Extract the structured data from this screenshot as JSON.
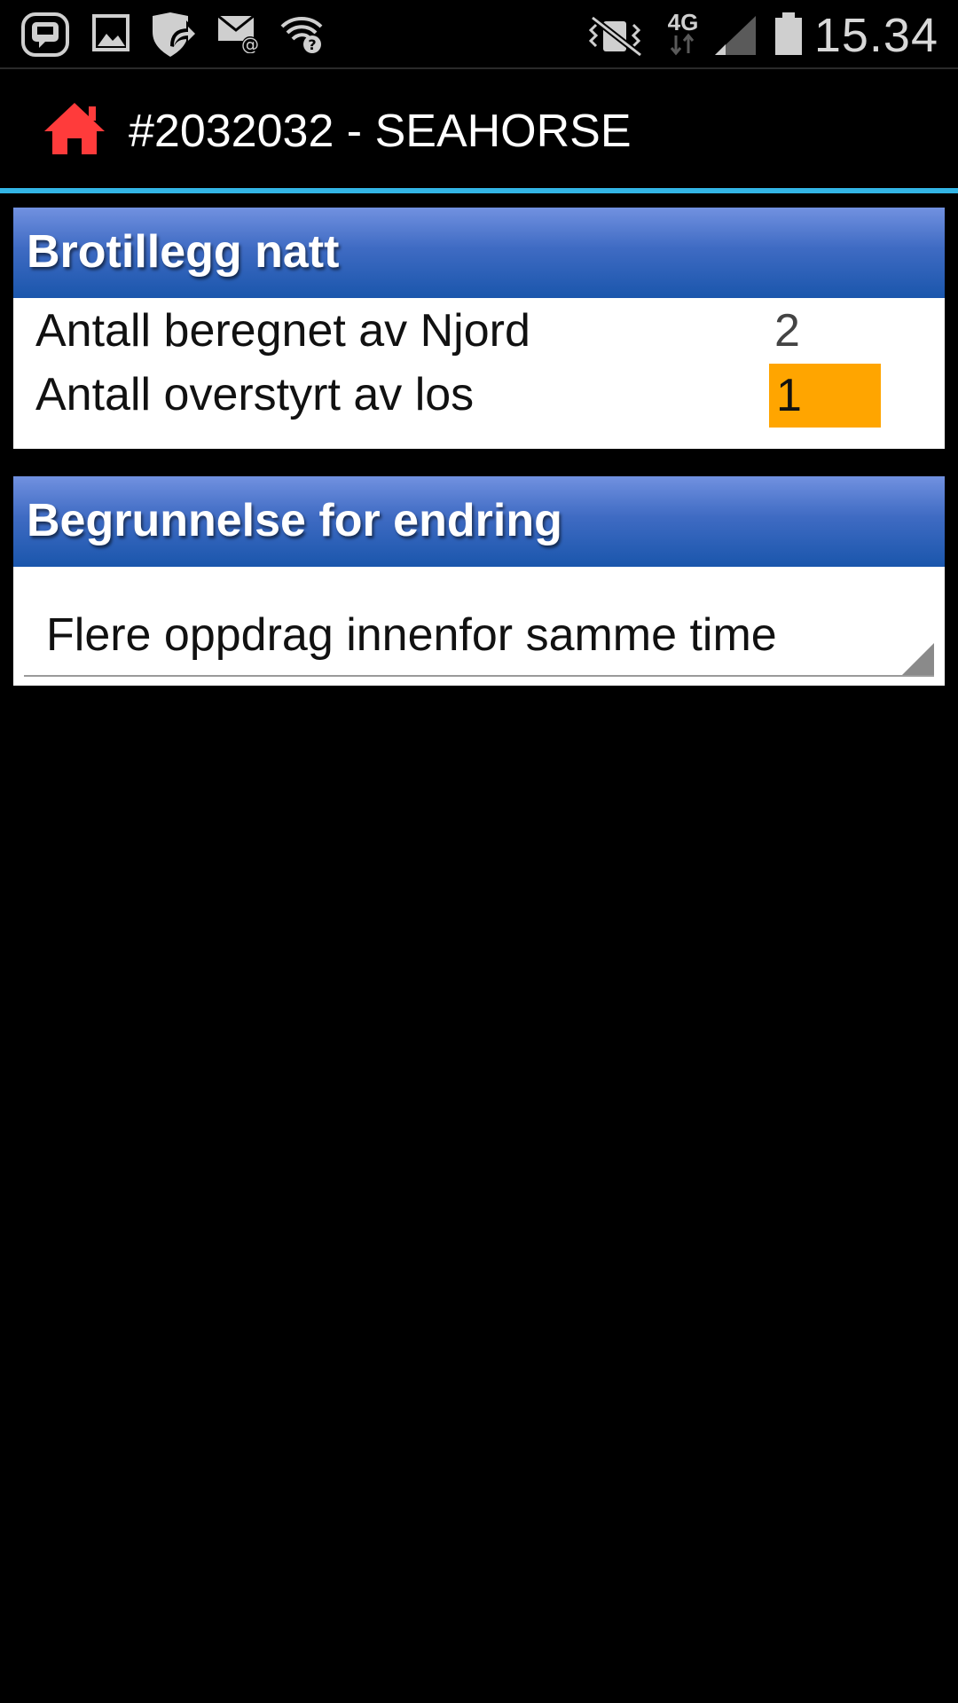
{
  "status_bar": {
    "icons": [
      "messenger-icon",
      "gallery-icon",
      "vpn-shield-icon",
      "email-icon",
      "wifi-unknown-icon",
      "vibrate-mute-icon",
      "network-4g-icon",
      "signal-icon",
      "battery-icon"
    ],
    "network_label": "4G",
    "time": "15.34"
  },
  "action_bar": {
    "title": "#2032032 - SEAHORSE",
    "home_icon_color": "#ff3b3b",
    "divider_color": "#33b5e5"
  },
  "panel_night": {
    "title": "Brotillegg natt",
    "rows": [
      {
        "label": "Antall beregnet av Njord",
        "value": "2"
      },
      {
        "label": "Antall overstyrt av los",
        "value": "1"
      }
    ],
    "override_color": "#ffa500"
  },
  "panel_reason": {
    "title": "Begrunnelse for endring",
    "selected_value": "Flere oppdrag innenfor samme time"
  }
}
